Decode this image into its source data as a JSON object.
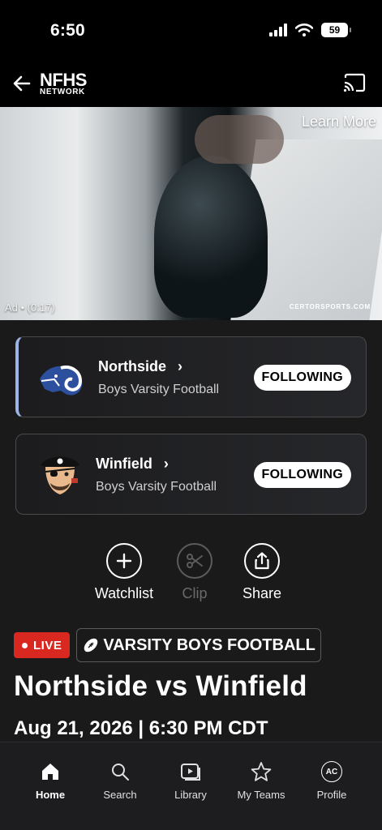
{
  "status_bar": {
    "time": "6:50",
    "battery": "59"
  },
  "header": {
    "logo_main": "NFHS",
    "logo_sub": "NETWORK"
  },
  "video": {
    "learn_more": "Learn More",
    "ad_label": "Ad • (0:17)",
    "sponsor": "CERTORSPORTS.COM"
  },
  "teams": [
    {
      "name": "Northside",
      "subtitle": "Boys Varsity Football",
      "follow_label": "FOLLOWING"
    },
    {
      "name": "Winfield",
      "subtitle": "Boys Varsity Football",
      "follow_label": "FOLLOWING"
    }
  ],
  "actions": {
    "watchlist": "Watchlist",
    "clip": "Clip",
    "share": "Share"
  },
  "event": {
    "live_label": "LIVE",
    "sport_label": "VARSITY BOYS FOOTBALL",
    "title": "Northside vs Winfield",
    "datetime": "Aug 21, 2026 | 6:30 PM CDT"
  },
  "tabs": {
    "home": "Home",
    "search": "Search",
    "library": "Library",
    "my_teams": "My Teams",
    "profile": "Profile",
    "profile_initials": "AC"
  },
  "colors": {
    "live": "#d8281f",
    "accent_bar": "#9db3e6",
    "background": "#1a1a1a"
  },
  "icons": [
    "back-arrow-icon",
    "cast-icon",
    "plus-icon",
    "scissors-icon",
    "share-icon",
    "football-icon",
    "home-icon",
    "search-icon",
    "library-icon",
    "star-icon"
  ]
}
